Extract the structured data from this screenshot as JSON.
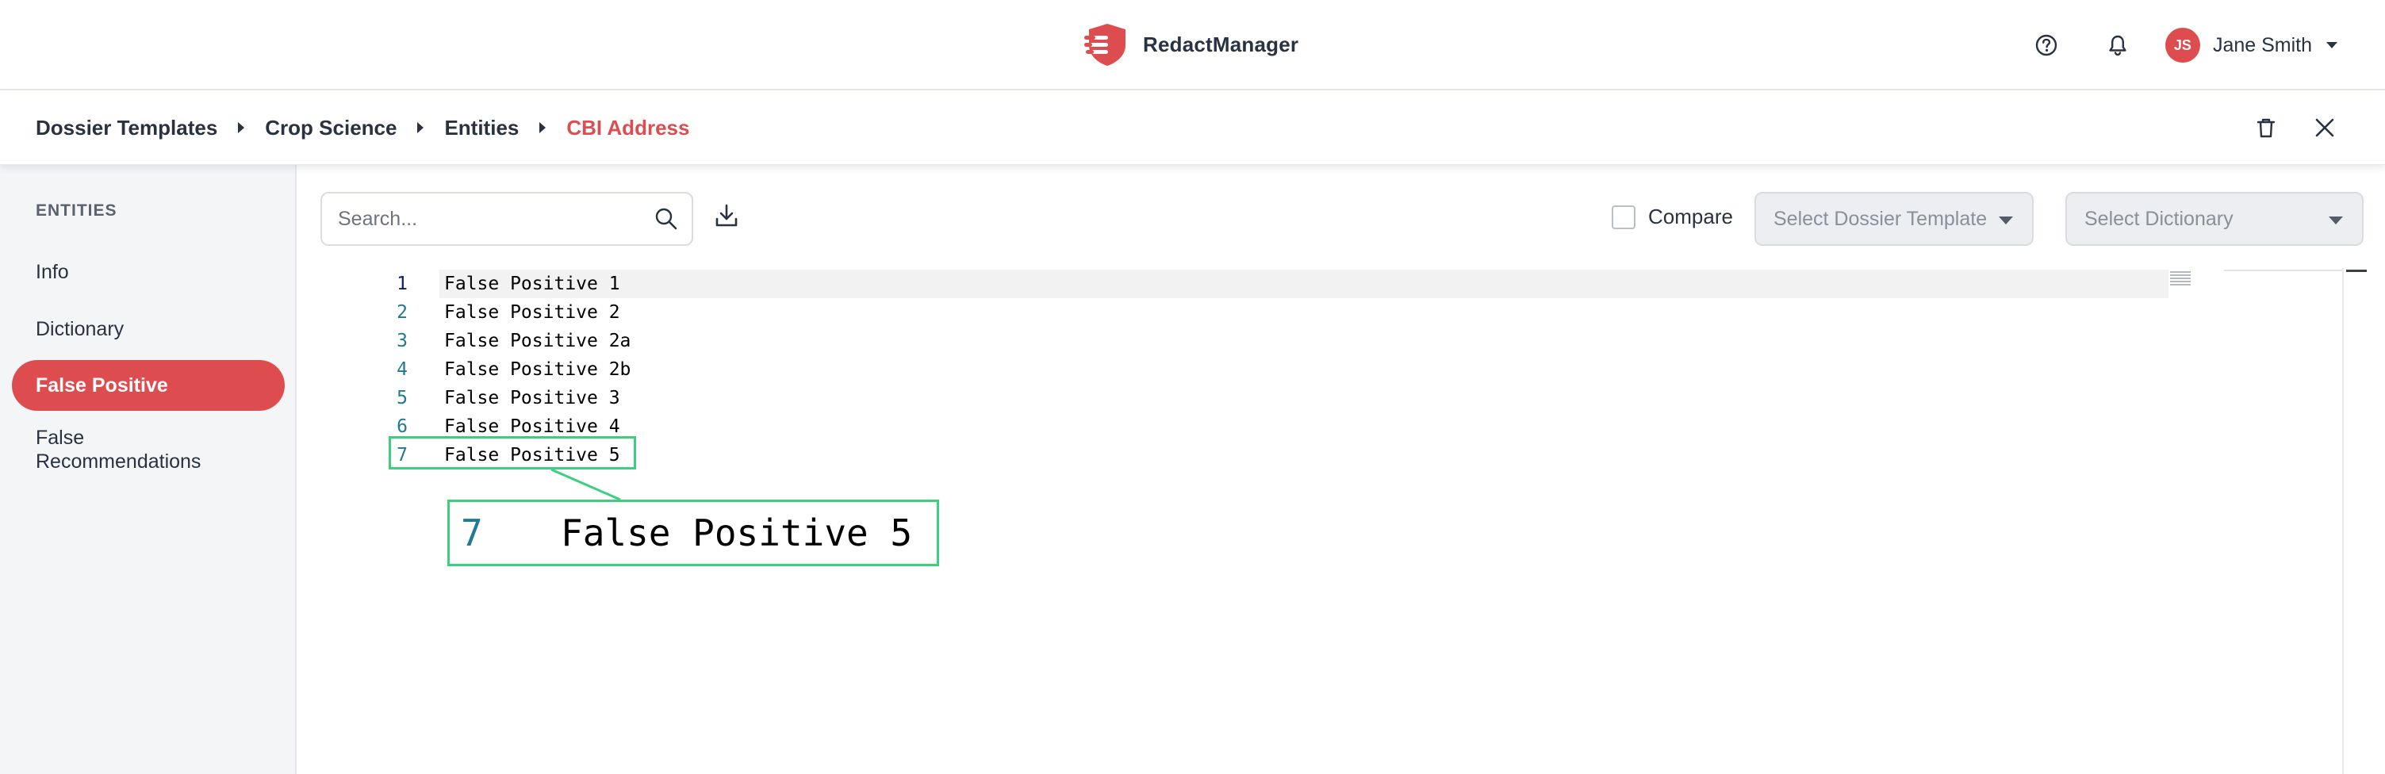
{
  "app": {
    "name": "RedactManager"
  },
  "header": {
    "user_initials": "JS",
    "user_name": "Jane Smith",
    "icons": [
      "help-icon",
      "bell-icon",
      "chevron-down-icon"
    ]
  },
  "breadcrumb": {
    "items": [
      "Dossier Templates",
      "Crop Science",
      "Entities",
      "CBI Address"
    ],
    "actions": [
      "trash-icon",
      "close-icon"
    ]
  },
  "sidebar": {
    "heading": "ENTITIES",
    "items": [
      {
        "label": "Info",
        "active": false
      },
      {
        "label": "Dictionary",
        "active": false
      },
      {
        "label": "False Positive",
        "active": true
      },
      {
        "label": "False Recommendations",
        "active": false
      }
    ]
  },
  "toolbar": {
    "search_placeholder": "Search...",
    "compare_label": "Compare",
    "compare_checked": false,
    "template_placeholder": "Select Dossier Template",
    "dictionary_placeholder": "Select Dictionary"
  },
  "editor": {
    "lines": [
      {
        "num": "1",
        "text": "False Positive 1"
      },
      {
        "num": "2",
        "text": "False Positive 2"
      },
      {
        "num": "3",
        "text": "False Positive 2a"
      },
      {
        "num": "4",
        "text": "False Positive 2b"
      },
      {
        "num": "5",
        "text": "False Positive 3"
      },
      {
        "num": "6",
        "text": "False Positive 4"
      },
      {
        "num": "7",
        "text": "False Positive 5"
      }
    ],
    "current_line": 1
  },
  "callout": {
    "num": "7",
    "text": "False Positive 5"
  },
  "colors": {
    "accent": "#dd4d50",
    "text": "#283241",
    "highlight": "#3ccf7f",
    "line_number": "#237893"
  }
}
